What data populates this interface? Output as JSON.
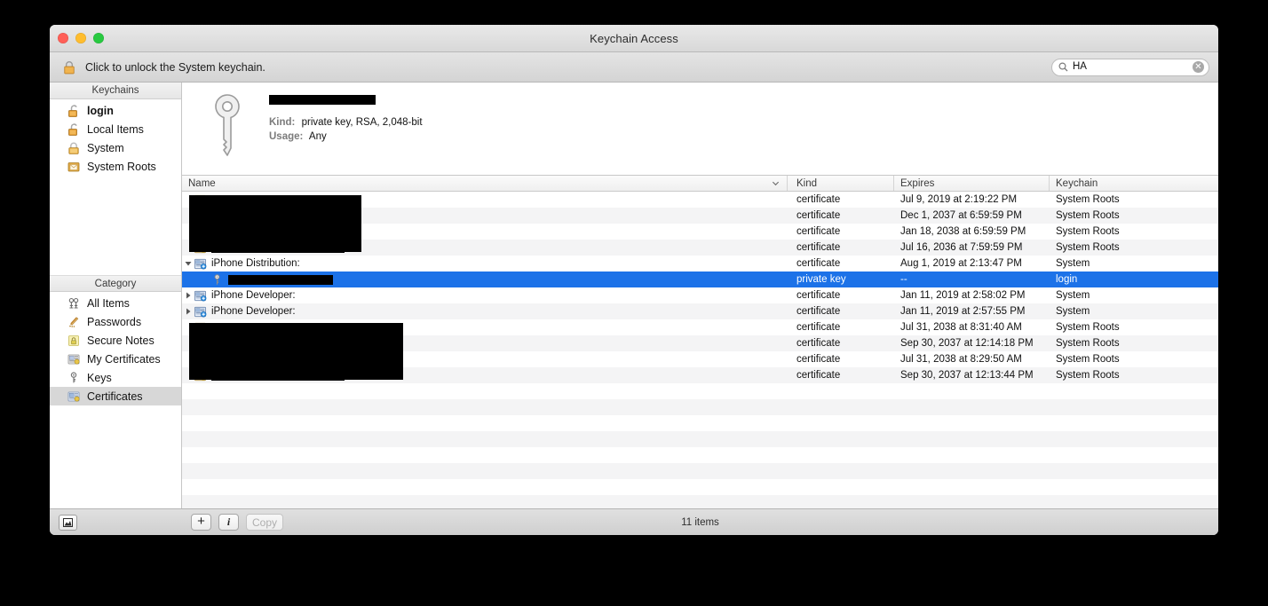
{
  "window": {
    "title": "Keychain Access",
    "traffic_lights": [
      "close",
      "minimize",
      "zoom"
    ]
  },
  "toolbar": {
    "unlock_icon": "lock-closed-icon",
    "unlock_text": "Click to unlock the System keychain.",
    "search": {
      "icon": "search-icon",
      "value": "HA",
      "placeholder": "Search",
      "clear_icon": "clear-icon",
      "clear_glyph": "✕"
    }
  },
  "sidebar": {
    "keychains_header": "Keychains",
    "keychains": [
      {
        "label": "login",
        "icon": "unlocked-keychain-icon",
        "bold": true,
        "selected": false
      },
      {
        "label": "Local Items",
        "icon": "unlocked-keychain-icon",
        "bold": false,
        "selected": false
      },
      {
        "label": "System",
        "icon": "locked-keychain-icon",
        "bold": false,
        "selected": false
      },
      {
        "label": "System Roots",
        "icon": "system-roots-folder-icon",
        "bold": false,
        "selected": false
      }
    ],
    "category_header": "Category",
    "categories": [
      {
        "label": "All Items",
        "icon": "all-items-icon",
        "selected": false
      },
      {
        "label": "Passwords",
        "icon": "passwords-icon",
        "selected": false
      },
      {
        "label": "Secure Notes",
        "icon": "secure-notes-icon",
        "selected": false
      },
      {
        "label": "My Certificates",
        "icon": "my-certificates-icon",
        "selected": false
      },
      {
        "label": "Keys",
        "icon": "keys-icon",
        "selected": false
      },
      {
        "label": "Certificates",
        "icon": "certificates-icon",
        "selected": true
      }
    ]
  },
  "detail": {
    "icon": "private-key-icon",
    "title_redacted": true,
    "kind_label": "Kind:",
    "kind_value": "private key, RSA, 2,048-bit",
    "usage_label": "Usage:",
    "usage_value": "Any"
  },
  "table": {
    "columns": {
      "name": "Name",
      "kind": "Kind",
      "expires": "Expires",
      "keychain": "Keychain"
    },
    "sort_icon": "chevron-down-icon",
    "rows": [
      {
        "name": "",
        "redacted": true,
        "icon": "certificate-icon",
        "kind": "certificate",
        "expires": "Jul 9, 2019 at 2:19:22 PM",
        "keychain": "System Roots",
        "level": 1,
        "twisty": "",
        "selected": false
      },
      {
        "name": "",
        "redacted": true,
        "icon": "certificate-icon",
        "kind": "certificate",
        "expires": "Dec 1, 2037 at 6:59:59 PM",
        "keychain": "System Roots",
        "level": 1,
        "twisty": "",
        "selected": false
      },
      {
        "name": "",
        "redacted": true,
        "icon": "certificate-icon",
        "kind": "certificate",
        "expires": "Jan 18, 2038 at 6:59:59 PM",
        "keychain": "System Roots",
        "level": 1,
        "twisty": "",
        "selected": false
      },
      {
        "name": "",
        "redacted": true,
        "icon": "certificate-icon",
        "kind": "certificate",
        "expires": "Jul 16, 2036 at 7:59:59 PM",
        "keychain": "System Roots",
        "level": 1,
        "twisty": "",
        "selected": false
      },
      {
        "name": "iPhone Distribution:",
        "redacted": false,
        "icon": "identity-certificate-icon",
        "kind": "certificate",
        "expires": "Aug 1, 2019 at 2:13:47 PM",
        "keychain": "System",
        "level": 0,
        "twisty": "expanded",
        "selected": false
      },
      {
        "name": "",
        "redacted": true,
        "icon": "private-key-icon",
        "kind": "private key",
        "expires": "--",
        "keychain": "login",
        "level": 2,
        "twisty": "",
        "selected": true
      },
      {
        "name": "iPhone Developer:",
        "redacted": false,
        "icon": "identity-certificate-icon",
        "kind": "certificate",
        "expires": "Jan 11, 2019 at 2:58:02 PM",
        "keychain": "System",
        "level": 0,
        "twisty": "collapsed",
        "selected": false
      },
      {
        "name": "iPhone Developer:",
        "redacted": false,
        "icon": "identity-certificate-icon",
        "kind": "certificate",
        "expires": "Jan 11, 2019 at 2:57:55 PM",
        "keychain": "System",
        "level": 0,
        "twisty": "collapsed",
        "selected": false
      },
      {
        "name": "",
        "redacted": true,
        "icon": "certificate-icon",
        "kind": "certificate",
        "expires": "Jul 31, 2038 at 8:31:40 AM",
        "keychain": "System Roots",
        "level": 1,
        "twisty": "",
        "selected": false
      },
      {
        "name": "",
        "redacted": true,
        "icon": "certificate-icon",
        "kind": "certificate",
        "expires": "Sep 30, 2037 at 12:14:18 PM",
        "keychain": "System Roots",
        "level": 1,
        "twisty": "",
        "selected": false
      },
      {
        "name": "",
        "redacted": true,
        "icon": "certificate-icon",
        "kind": "certificate",
        "expires": "Jul 31, 2038 at 8:29:50 AM",
        "keychain": "System Roots",
        "level": 1,
        "twisty": "",
        "selected": false
      },
      {
        "name": "",
        "redacted": true,
        "icon": "certificate-icon",
        "kind": "certificate",
        "expires": "Sep 30, 2037 at 12:13:44 PM",
        "keychain": "System Roots",
        "level": 1,
        "twisty": "",
        "selected": false
      }
    ],
    "empty_row_count": 9
  },
  "bottom": {
    "sidebar_toggle_icon": "sidebar-toggle-icon",
    "add_label": "+",
    "info_label": "i",
    "copy_label": "Copy",
    "copy_disabled": true,
    "item_count": "11 items"
  },
  "colors": {
    "selection_blue": "#1c72e8",
    "row_alt": "#f4f4f5",
    "sidebar_selection": "#d7d7d7"
  }
}
